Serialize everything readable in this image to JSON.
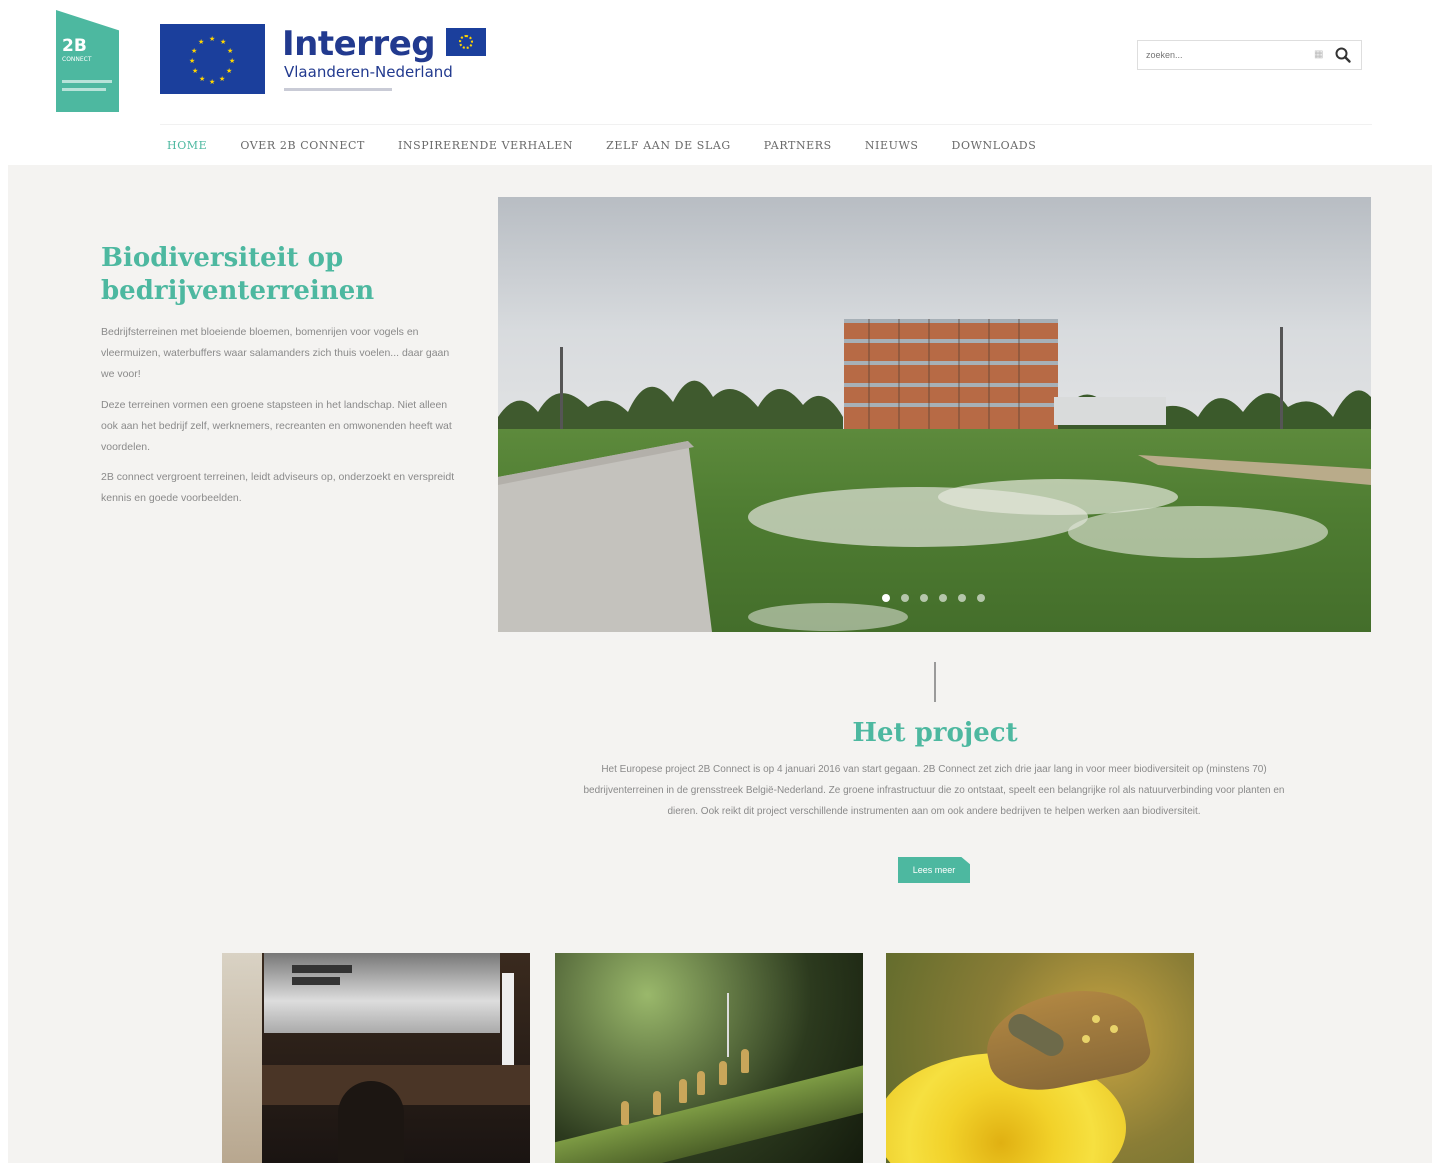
{
  "header": {
    "logo_2b": {
      "big": "2B",
      "small": "CONNECT"
    },
    "interreg": {
      "title": "Interreg",
      "subtitle": "Vlaanderen-Nederland"
    },
    "search": {
      "placeholder": "zoeken..."
    }
  },
  "nav": {
    "items": [
      {
        "label": "HOME",
        "active": true
      },
      {
        "label": "OVER 2B CONNECT",
        "active": false
      },
      {
        "label": "INSPIRERENDE VERHALEN",
        "active": false
      },
      {
        "label": "ZELF AAN DE SLAG",
        "active": false
      },
      {
        "label": "PARTNERS",
        "active": false
      },
      {
        "label": "NIEUWS",
        "active": false
      },
      {
        "label": "DOWNLOADS",
        "active": false
      }
    ]
  },
  "intro": {
    "title": "Biodiversiteit op bedrijventerreinen",
    "paragraphs": [
      "Bedrijfsterreinen met bloeiende bloemen, bomenrijen voor vogels en vleermuizen, waterbuffers waar salamanders zich thuis voelen... daar gaan we voor!",
      "Deze terreinen vormen een groene stapsteen in het landschap. Niet alleen ook aan het bedrijf zelf, werknemers, recreanten en omwonenden heeft wat voordelen.",
      "2B connect vergroent terreinen, leidt adviseurs op, onderzoekt en verspreidt kennis en goede voorbeelden."
    ]
  },
  "slider": {
    "dot_count": 6,
    "active_index": 0
  },
  "project": {
    "title": "Het project",
    "text": "Het Europese project 2B Connect is op 4 januari 2016 van start gegaan. 2B Connect zet zich drie jaar lang in voor meer biodiversiteit op (minstens 70) bedrijventerreinen in de grensstreek België-Nederland. Ze groene infrastructuur die zo ontstaat, speelt een belangrijke rol als natuurverbinding voor planten en dieren. Ook reikt dit project verschillende instrumenten aan om ook andere bedrijven te helpen werken aan biodiversiteit.",
    "button": "Lees meer"
  },
  "colors": {
    "accent": "#4db8a0",
    "band": "#f4f3f1",
    "text": "#8a8a8a",
    "interreg_blue": "#223a8f",
    "eu_blue": "#1b3f9c"
  }
}
